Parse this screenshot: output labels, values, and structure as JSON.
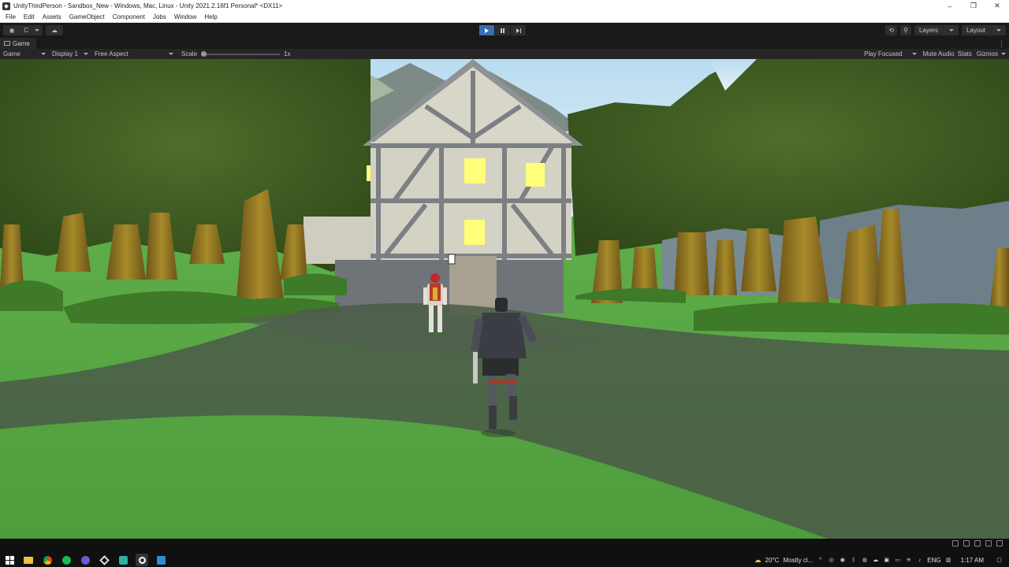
{
  "window": {
    "title": "UnityThirdPerson - Sandbox_New - Windows, Mac, Linux - Unity 2021.2.16f1 Personal* <DX11>",
    "controls": [
      "–",
      "❐",
      "✕"
    ]
  },
  "menu": [
    "File",
    "Edit",
    "Assets",
    "GameObject",
    "Component",
    "Jobs",
    "Window",
    "Help"
  ],
  "toolbar": {
    "account_label": "C",
    "layers_label": "Layers",
    "layout_label": "Layout"
  },
  "tab": {
    "label": "Game"
  },
  "gamebar": {
    "mode": "Game",
    "display": "Display 1",
    "aspect": "Free Aspect",
    "scale_label": "Scale",
    "scale_value": "1x",
    "play_focused": "Play Focused",
    "mute_audio": "Mute Audio",
    "stats": "Stats",
    "gizmos": "Gizmos"
  },
  "taskbar": {
    "weather": "20°C",
    "weather_desc": "Mostly cl...",
    "language": "ENG",
    "time": "1:17 AM"
  },
  "colors": {
    "play_active": "#3a6fb0",
    "grass": "#5aa845",
    "sky": "#cfe6f3",
    "window_light": "#ffff7a"
  }
}
